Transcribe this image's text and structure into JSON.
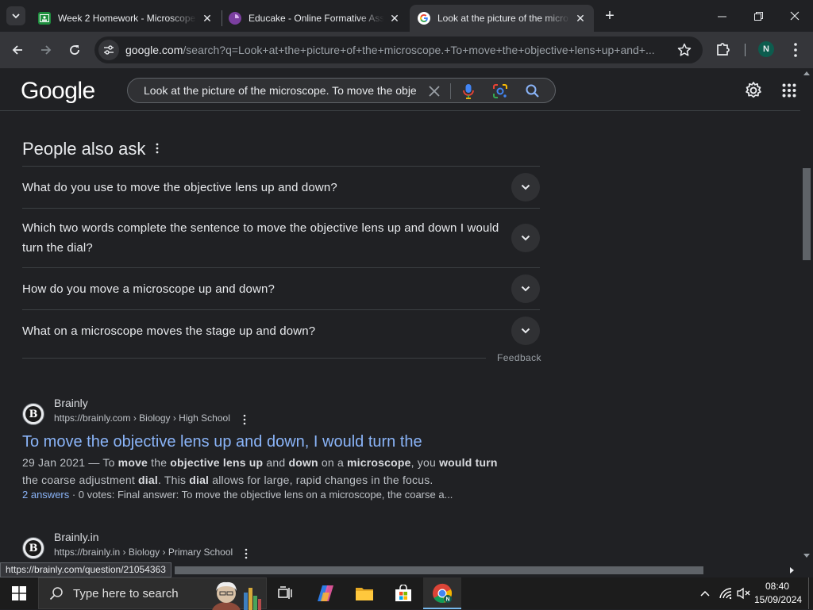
{
  "tabs": [
    {
      "title": "Week 2 Homework - Microscope",
      "icon": "google-classroom-icon",
      "color": "#1e8e3e"
    },
    {
      "title": "Educake - Online Formative Ass",
      "icon": "educake-icon",
      "color": "#7b3fa0"
    },
    {
      "title": "Look at the picture of the micro",
      "icon": "google-g-icon",
      "active": true
    }
  ],
  "toolbar": {
    "url_domain": "google.com",
    "url_rest": "/search?q=Look+at+the+picture+of+the+microscope.+To+move+the+objective+lens+up+and+...",
    "profile_initial": "N"
  },
  "google": {
    "logo": "Google",
    "query": "Look at the picture of the microscope. To move the objective lens up and down, I would turn the"
  },
  "paa": {
    "title": "People also ask",
    "questions": [
      "What do you use to move the objective lens up and down?",
      "Which two words complete the sentence to move the objective lens up and down I would turn the dial?",
      "How do you move a microscope up and down?",
      "What on a microscope moves the stage up and down?"
    ],
    "feedback": "Feedback"
  },
  "results": [
    {
      "site": "Brainly",
      "url": "https://brainly.com › Biology › High School",
      "title": "To move the objective lens up and down, I would turn the",
      "date": "29 Jan 2021",
      "snippet_parts": [
        {
          "t": "29 Jan 2021 — To "
        },
        {
          "t": "move",
          "b": true
        },
        {
          "t": " the "
        },
        {
          "t": "objective lens up",
          "b": true
        },
        {
          "t": " and "
        },
        {
          "t": "down",
          "b": true
        },
        {
          "t": " on a "
        },
        {
          "t": "microscope",
          "b": true
        },
        {
          "t": ", you "
        },
        {
          "t": "would",
          "b": true
        },
        {
          "t": " "
        },
        {
          "t": "turn",
          "b": true
        },
        {
          "t": " the coarse adjustment "
        },
        {
          "t": "dial",
          "b": true
        },
        {
          "t": ". This "
        },
        {
          "t": "dial",
          "b": true
        },
        {
          "t": " allows for large, rapid changes in the focus."
        }
      ],
      "answers_link": "2 answers",
      "meta": " · 0 votes: Final answer: To move the objective lens on a microscope, the coarse a..."
    },
    {
      "site": "Brainly.in",
      "url": "https://brainly.in › Biology › Primary School"
    }
  ],
  "status_url": "https://brainly.com/question/21054363",
  "taskbar": {
    "search_placeholder": "Type here to search",
    "time": "08:40",
    "date": "15/09/2024"
  }
}
